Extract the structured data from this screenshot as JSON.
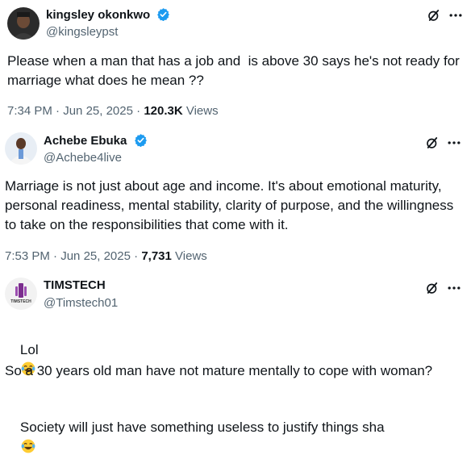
{
  "posts": [
    {
      "author_name": "kingsley okonkwo",
      "author_handle": "@kingsleypst",
      "verified": true,
      "text": "Please when a man that has a job and  is above 30 says he's not ready for marriage what does he mean ??",
      "time": "7:34 PM",
      "date": "Jun 25, 2025",
      "views_count": "120.3K",
      "views_label": "Views"
    },
    {
      "author_name": "Achebe Ebuka",
      "author_handle": "@Achebe4live",
      "verified": true,
      "text": "Marriage is not just about age and income. It's about emotional maturity, personal readiness, mental stability, clarity of purpose, and the willingness to take on the responsibilities that come with it.",
      "time": "7:53 PM",
      "date": "Jun 25, 2025",
      "views_count": "7,731",
      "views_label": "Views"
    },
    {
      "author_name": "TIMSTECH",
      "author_handle": "@Timstech01",
      "avatar_text": "TIMSTECH",
      "verified": false,
      "line1": "Lol",
      "line2": "So a 30 years old man have not mature mentally to cope with woman?",
      "line3": "Society will just have something useless to justify things sha"
    }
  ],
  "separator": "·",
  "colors": {
    "text": "#0f1419",
    "secondary": "#536471",
    "verified": "#1d9bf0"
  },
  "icons": {
    "grok": "grok-icon",
    "more": "more-icon",
    "verified": "verified-badge-icon",
    "emoji": "face-with-tears-of-joy"
  }
}
